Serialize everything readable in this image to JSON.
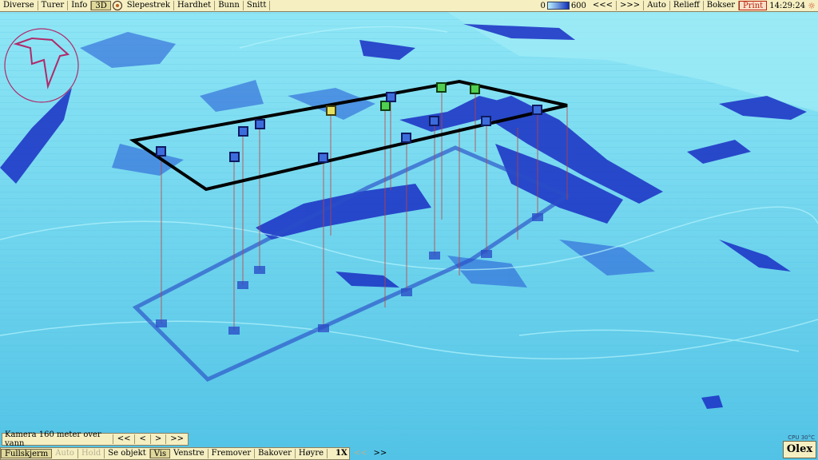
{
  "topbar": {
    "left_buttons": [
      "Diverse",
      "Turer",
      "Info",
      "3D",
      "Slepestrek",
      "Hardhet",
      "Bunn",
      "Snitt"
    ],
    "depth_min": "0",
    "depth_max": "600",
    "nav_back": "<<<",
    "nav_fwd": ">>>",
    "right_buttons": [
      "Auto",
      "Relieff",
      "Bokser"
    ],
    "print": "Print",
    "clock": "14:29:24"
  },
  "camera": {
    "label": "Kamera 160 meter over vann",
    "buttons": [
      "<<",
      "<",
      ">",
      ">>"
    ]
  },
  "bottombar": {
    "buttons": [
      "Fullskjerm",
      "Auto",
      "Hold",
      "Se objekt",
      "Vis",
      "Venstre",
      "Fremover",
      "Bakover",
      "Høyre",
      "1X",
      "<<",
      ">>"
    ]
  },
  "status": {
    "cpu": "CPU 30°C",
    "brand": "Olex"
  },
  "colors": {
    "water_light": "#7fe3f5",
    "water_mid": "#3fb6e0",
    "deep": "#1228b8",
    "menu_bg": "#f5efc2"
  },
  "icons": {
    "compass": "north-arrow-compass-icon",
    "clock_indicator": "sun-icon"
  }
}
